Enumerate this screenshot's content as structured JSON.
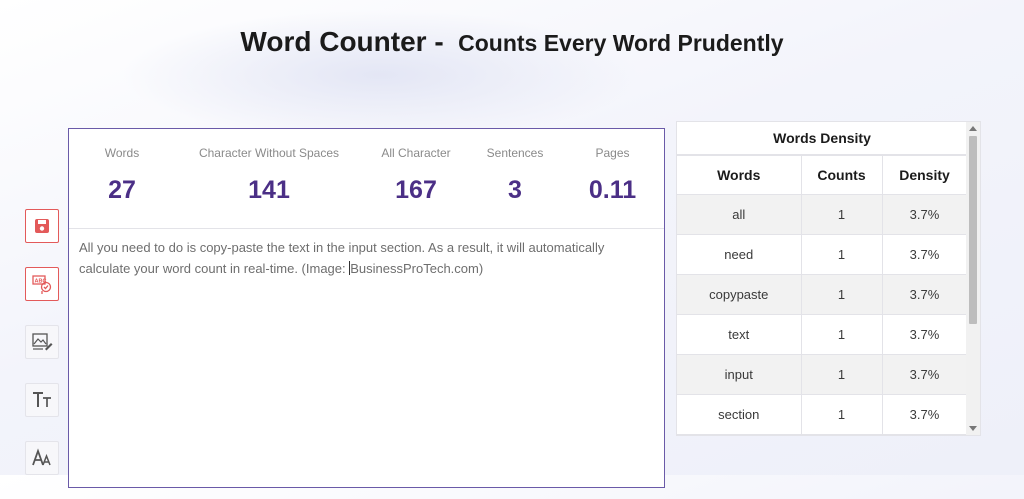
{
  "header": {
    "title_main": "Word Counter -",
    "title_sub": "Counts Every Word Prudently"
  },
  "tools": [
    {
      "name": "save-icon"
    },
    {
      "name": "spell-check-icon"
    },
    {
      "name": "image-edit-icon"
    },
    {
      "name": "text-case-icon"
    },
    {
      "name": "font-size-icon"
    }
  ],
  "stats": {
    "words": {
      "label": "Words",
      "value": "27"
    },
    "chars_no_spaces": {
      "label": "Character Without Spaces",
      "value": "141"
    },
    "all_chars": {
      "label": "All Character",
      "value": "167"
    },
    "sentences": {
      "label": "Sentences",
      "value": "3"
    },
    "pages": {
      "label": "Pages",
      "value": "0.11"
    }
  },
  "editor": {
    "text_before_caret": "All you need to do is copy-paste the text in the input section. As a result, it will automatically calculate your word count in real-time. (Image: ",
    "text_after_caret": "BusinessProTech.com)"
  },
  "density": {
    "title": "Words Density",
    "headers": [
      "Words",
      "Counts",
      "Density"
    ],
    "rows": [
      {
        "word": "all",
        "count": "1",
        "density": "3.7%"
      },
      {
        "word": "need",
        "count": "1",
        "density": "3.7%"
      },
      {
        "word": "copypaste",
        "count": "1",
        "density": "3.7%"
      },
      {
        "word": "text",
        "count": "1",
        "density": "3.7%"
      },
      {
        "word": "input",
        "count": "1",
        "density": "3.7%"
      },
      {
        "word": "section",
        "count": "1",
        "density": "3.7%"
      }
    ]
  },
  "colors": {
    "accent": "#4b2f86",
    "editor_border": "#6a5aa8",
    "tool_red": "#e35a5a"
  }
}
